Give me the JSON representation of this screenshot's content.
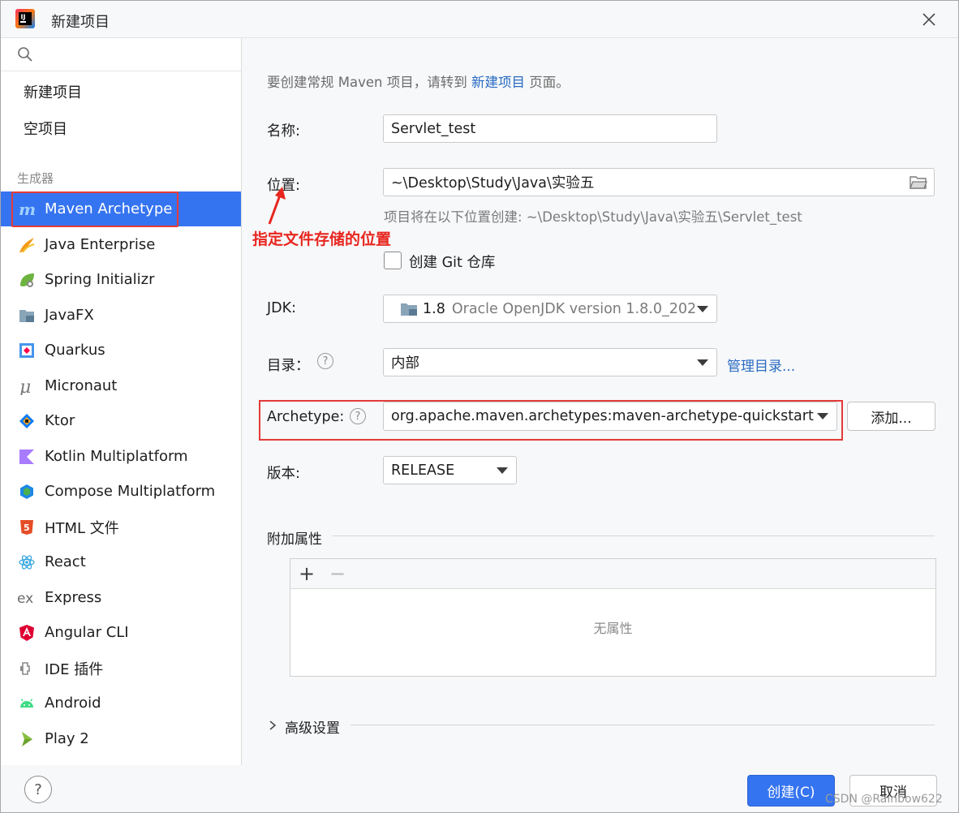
{
  "window": {
    "title": "新建项目"
  },
  "sidebar": {
    "search_placeholder": "",
    "top_items": [
      {
        "label": "新建项目"
      },
      {
        "label": "空项目"
      }
    ],
    "group_label": "生成器",
    "items": [
      {
        "label": "Maven Archetype",
        "icon": "maven-icon",
        "selected": true
      },
      {
        "label": "Java Enterprise",
        "icon": "java-enterprise-icon"
      },
      {
        "label": "Spring Initializr",
        "icon": "spring-icon"
      },
      {
        "label": "JavaFX",
        "icon": "javafx-icon"
      },
      {
        "label": "Quarkus",
        "icon": "quarkus-icon"
      },
      {
        "label": "Micronaut",
        "icon": "micronaut-icon"
      },
      {
        "label": "Ktor",
        "icon": "ktor-icon"
      },
      {
        "label": "Kotlin Multiplatform",
        "icon": "kotlin-icon"
      },
      {
        "label": "Compose Multiplatform",
        "icon": "compose-icon"
      },
      {
        "label": "HTML 文件",
        "icon": "html5-icon"
      },
      {
        "label": "React",
        "icon": "react-icon"
      },
      {
        "label": "Express",
        "icon": "express-icon"
      },
      {
        "label": "Angular CLI",
        "icon": "angular-icon"
      },
      {
        "label": "IDE 插件",
        "icon": "plugin-icon"
      },
      {
        "label": "Android",
        "icon": "android-icon"
      },
      {
        "label": "Play 2",
        "icon": "play-icon"
      }
    ],
    "help_label": "?"
  },
  "form": {
    "hint_prefix": "要创建常规 Maven 项目，请转到",
    "hint_link": "新建项目",
    "hint_suffix": "页面。",
    "name_label": "名称:",
    "name_value": "Servlet_test",
    "location_label": "位置:",
    "location_value": "~\\Desktop\\Study\\Java\\实验五",
    "location_hint": "项目将在以下位置创建: ~\\Desktop\\Study\\Java\\实验五\\Servlet_test",
    "annotation": "指定文件存储的位置",
    "git_label": "创建 Git 仓库",
    "git_checked": false,
    "jdk_label": "JDK:",
    "jdk_version": "1.8",
    "jdk_desc": "Oracle OpenJDK version 1.8.0_202",
    "catalog_label": "目录：",
    "catalog_value": "内部",
    "catalog_link": "管理目录...",
    "archetype_label": "Archetype:",
    "archetype_value": "org.apache.maven.archetypes:maven-archetype-quickstart",
    "add_button": "添加...",
    "version_label": "版本:",
    "version_value": "RELEASE",
    "props_title": "附加属性",
    "props_add": "+",
    "props_remove": "−",
    "props_empty": "无属性",
    "advanced_title": "高级设置"
  },
  "footer": {
    "create_button": "创建(C)",
    "cancel_button": "取消",
    "watermark": "CSDN @Rainbow622"
  },
  "colors": {
    "accent": "#3574f0",
    "link": "#2a6bc2",
    "annotation": "#e8261f"
  }
}
